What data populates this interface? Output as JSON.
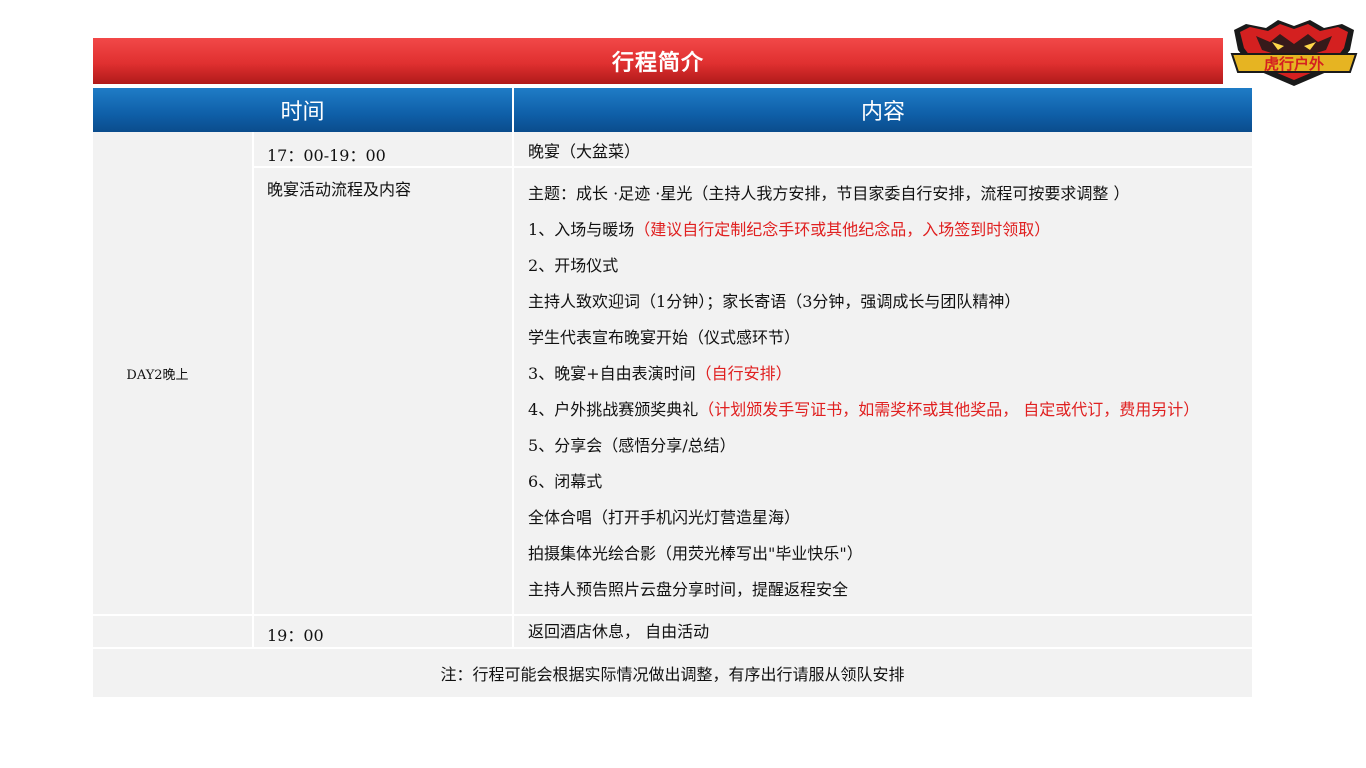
{
  "banner": {
    "title": "行程简介"
  },
  "logo": {
    "text": "虎行户外",
    "icon": "tiger-head-icon",
    "colors": {
      "red": "#d42020",
      "gold": "#e6b422",
      "dark": "#1a1a1a"
    }
  },
  "table": {
    "headers": {
      "time": "时间",
      "content": "内容"
    },
    "day": "DAY2晚上",
    "rows": [
      {
        "time": "17：00-19：00",
        "content": "晚宴（大盆菜）"
      },
      {
        "time": "晚宴活动流程及内容",
        "lines": [
          {
            "text": "主题：成长 ·足迹 ·星光（主持人我方安排，节目家委自行安排，流程可按要求调整 ）",
            "note": ""
          },
          {
            "text": "1、入场与暖场",
            "note": "（建议自行定制纪念手环或其他纪念品，入场签到时领取）"
          },
          {
            "text": "2、开场仪式",
            "note": ""
          },
          {
            "text": "主持人致欢迎词（1分钟）；家长寄语（3分钟，强调成长与团队精神）",
            "note": ""
          },
          {
            "text": "学生代表宣布晚宴开始（仪式感环节）",
            "note": ""
          },
          {
            "text": "3、晚宴+自由表演时间",
            "note": "（自行安排）"
          },
          {
            "text": " 4、户外挑战赛颁奖典礼",
            "note": "（计划颁发手写证书，如需奖杯或其他奖品， 自定或代订，费用另计）"
          },
          {
            "text": "5、分享会（感悟分享/总结）",
            "note": ""
          },
          {
            "text": "6、闭幕式",
            "note": ""
          },
          {
            "text": "全体合唱（打开手机闪光灯营造星海）",
            "note": ""
          },
          {
            "text": "拍摄集体光绘合影（用荧光棒写出\"毕业快乐\"）",
            "note": ""
          },
          {
            "text": "主持人预告照片云盘分享时间，提醒返程安全",
            "note": ""
          }
        ]
      },
      {
        "time": "19：00",
        "content": "返回酒店休息， 自由活动"
      }
    ],
    "note": "注：行程可能会根据实际情况做出调整，有序出行请服从领队安排"
  }
}
